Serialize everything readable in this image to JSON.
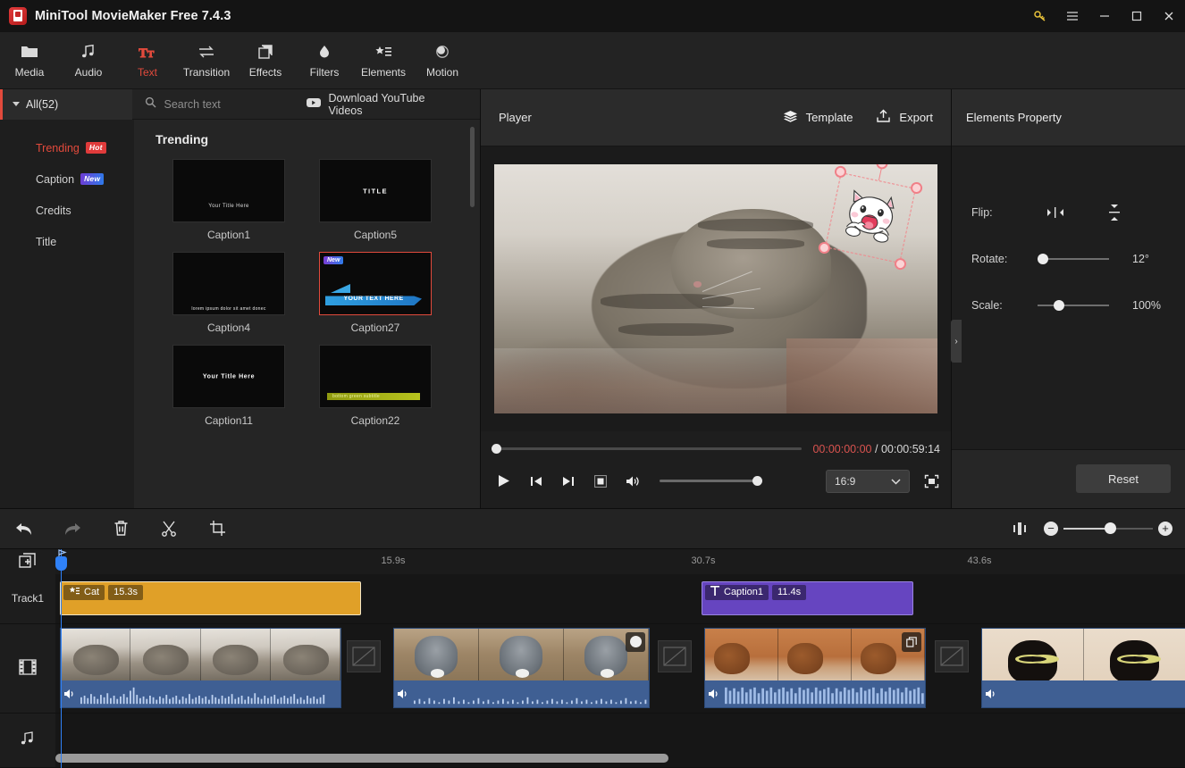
{
  "titlebar": {
    "app_title": "MiniTool MovieMaker Free 7.4.3",
    "buttons": [
      {
        "name": "key-icon",
        "label": "Activate"
      },
      {
        "name": "menu-icon",
        "label": "Menu"
      },
      {
        "name": "minimize-icon",
        "label": "Minimize"
      },
      {
        "name": "maximize-icon",
        "label": "Maximize"
      },
      {
        "name": "close-icon",
        "label": "Close"
      }
    ]
  },
  "toolbar": {
    "items": [
      {
        "label": "Media",
        "icon": "folder-icon",
        "active": false
      },
      {
        "label": "Audio",
        "icon": "music-note-icon",
        "active": false
      },
      {
        "label": "Text",
        "icon": "text-icon",
        "active": true
      },
      {
        "label": "Transition",
        "icon": "transition-arrows-icon",
        "active": false
      },
      {
        "label": "Effects",
        "icon": "layers-square-icon",
        "active": false
      },
      {
        "label": "Filters",
        "icon": "droplet-icon",
        "active": false
      },
      {
        "label": "Elements",
        "icon": "star-list-icon",
        "active": false
      },
      {
        "label": "Motion",
        "icon": "motion-circle-icon",
        "active": false
      }
    ]
  },
  "library": {
    "all_filter": "All(52)",
    "search": {
      "placeholder": "Search text",
      "value": ""
    },
    "download_youtube": "Download YouTube Videos",
    "categories": [
      {
        "label": "Trending",
        "badge": "Hot",
        "badge_type": "hot",
        "active": true
      },
      {
        "label": "Caption",
        "badge": "New",
        "badge_type": "new",
        "active": false
      },
      {
        "label": "Credits",
        "badge": "",
        "badge_type": "",
        "active": false
      },
      {
        "label": "Title",
        "badge": "",
        "badge_type": "",
        "active": false
      }
    ],
    "section_title": "Trending",
    "templates": [
      {
        "name": "Caption1",
        "preview_text": "Your  Title Here",
        "style": "center-low",
        "selected": false,
        "badge": ""
      },
      {
        "name": "Caption5",
        "preview_text": "TITLE",
        "style": "center",
        "selected": false,
        "badge": ""
      },
      {
        "name": "Caption4",
        "preview_text": "lorem ipsum dolor sit amet donec",
        "style": "bottom",
        "selected": false,
        "badge": ""
      },
      {
        "name": "Caption27",
        "preview_text": "YOUR TEXT HERE",
        "style": "ribbon",
        "selected": true,
        "badge": "New"
      },
      {
        "name": "Caption11",
        "preview_text": "Your  Title Here",
        "style": "center",
        "selected": false,
        "badge": ""
      },
      {
        "name": "Caption22",
        "preview_text": "bottom green subtitle",
        "style": "yellowbar",
        "selected": false,
        "badge": ""
      }
    ]
  },
  "player": {
    "title": "Player",
    "template_button": "Template",
    "export_button": "Export",
    "current_time": "00:00:00:00",
    "separator": "/",
    "total_time": "00:00:59:14",
    "aspect_ratio": "16:9",
    "controls": [
      {
        "name": "play-button",
        "label": "Play"
      },
      {
        "name": "previous-frame-button",
        "label": "Previous frame"
      },
      {
        "name": "next-frame-button",
        "label": "Next frame"
      },
      {
        "name": "stop-button",
        "label": "Stop"
      },
      {
        "name": "volume-icon",
        "label": "Volume"
      }
    ],
    "fullscreen_label": "Fullscreen",
    "overlay": {
      "name": "cat-sticker",
      "rotation_deg": 12
    }
  },
  "properties": {
    "title": "Elements Property",
    "flip_label": "Flip:",
    "flip_horizontal": "Flip horizontal",
    "flip_vertical": "Flip vertical",
    "rotate_label": "Rotate:",
    "rotate_value": "12°",
    "rotate_pct": 6,
    "scale_label": "Scale:",
    "scale_value": "100%",
    "scale_pct": 30,
    "reset_button": "Reset"
  },
  "timeline": {
    "toolbar": [
      {
        "name": "undo-button",
        "label": "Undo",
        "enabled": true
      },
      {
        "name": "redo-button",
        "label": "Redo",
        "enabled": false
      },
      {
        "name": "delete-button",
        "label": "Delete",
        "enabled": true
      },
      {
        "name": "split-button",
        "label": "Split",
        "enabled": true
      },
      {
        "name": "crop-button",
        "label": "Crop",
        "enabled": true
      }
    ],
    "zoom": {
      "fit-icon": "Fit to timeline",
      "zoom_out": "−",
      "zoom_in": "+"
    },
    "add_track_label": "Add track",
    "ruler_ticks": [
      "15.9s",
      "30.7s",
      "43.6s"
    ],
    "tracks": [
      {
        "name": "Track1",
        "label": "Track1",
        "icon": ""
      },
      {
        "name": "video-track",
        "label": "",
        "icon": "film-icon"
      },
      {
        "name": "audio-track",
        "label": "",
        "icon": "music-icon"
      }
    ],
    "clips": {
      "element_clip": {
        "title": "Cat",
        "duration": "15.3s",
        "color": "#e0a028"
      },
      "text_clip": {
        "title": "Caption1",
        "duration": "11.4s",
        "color": "#6645c0"
      }
    },
    "video_clips": [
      {
        "name": "sleeping-cat-clip"
      },
      {
        "name": "grey-kitten-clip"
      },
      {
        "name": "brown-kitten-clip"
      },
      {
        "name": "black-cat-clip"
      }
    ]
  }
}
